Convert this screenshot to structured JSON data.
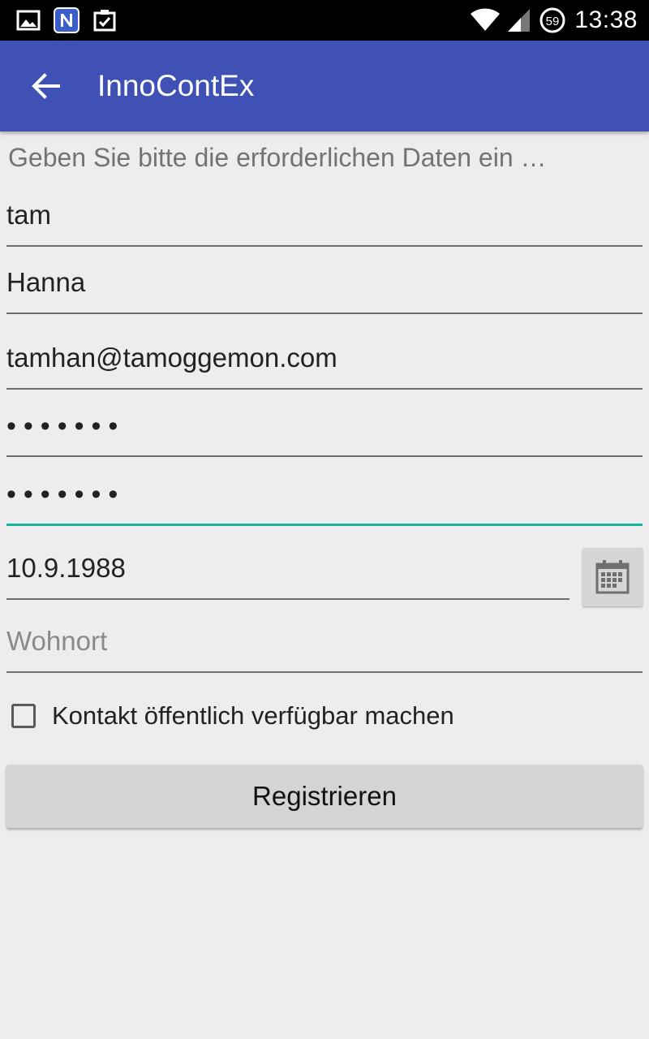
{
  "status_bar": {
    "time": "13:38",
    "battery_level": "59",
    "left_icons": [
      "image-icon",
      "n-app-icon",
      "clipboard-check-icon"
    ],
    "right_icons": [
      "wifi-icon",
      "cell-signal-icon",
      "battery-icon"
    ]
  },
  "app_bar": {
    "title": "InnoContEx",
    "back_icon": "arrow-left-icon",
    "color": "#3f51b5"
  },
  "form": {
    "instruction": "Geben Sie bitte die erforderlichen Daten ein …",
    "fields": {
      "username": {
        "value": "tam"
      },
      "name": {
        "value": "Hanna"
      },
      "email": {
        "value": "tamhan@tamoggemon.com"
      },
      "password": {
        "value": "•••••••"
      },
      "password_confirm": {
        "value": "•••••••",
        "focused": true
      },
      "birthdate": {
        "value": "10.9.1988"
      },
      "city": {
        "value": "",
        "placeholder": "Wohnort"
      }
    },
    "date_picker_icon": "calendar-icon",
    "public_contact": {
      "label": "Kontakt öffentlich verfügbar machen",
      "checked": false
    },
    "register_label": "Registrieren"
  },
  "colors": {
    "accent": "#13b5a0",
    "background": "#ededed",
    "status_bar": "#000000"
  }
}
